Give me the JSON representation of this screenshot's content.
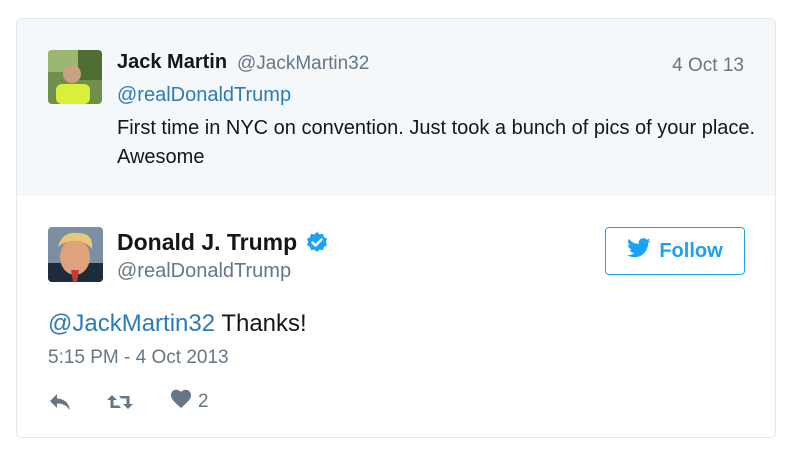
{
  "parent_tweet": {
    "author_name": "Jack Martin",
    "author_handle": "@JackMartin32",
    "date": "4 Oct 13",
    "mention": "@realDonaldTrump",
    "text": "First time in NYC on convention. Just took a bunch of pics of your place. Awesome"
  },
  "main_tweet": {
    "author_name": "Donald J. Trump",
    "author_handle": "@realDonaldTrump",
    "verified": true,
    "follow_label": "Follow",
    "mention": "@JackMartin32",
    "text": " Thanks!",
    "timestamp": "5:15 PM - 4 Oct 2013",
    "like_count": "2"
  },
  "icons": [
    "reply-icon",
    "retweet-icon",
    "heart-icon",
    "twitter-bird-icon",
    "verified-badge-icon"
  ],
  "colors": {
    "link": "#2b7bb9",
    "brand": "#1da1f2",
    "muted": "#657786",
    "parent_bg": "#f5f8fa"
  }
}
